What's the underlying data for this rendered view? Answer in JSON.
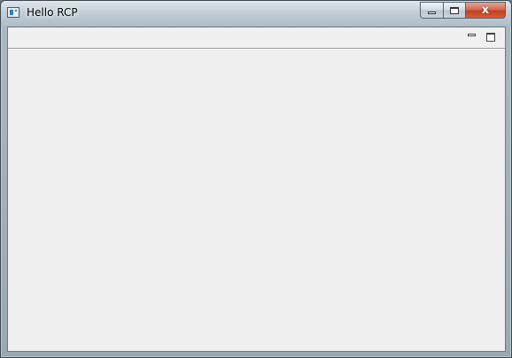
{
  "window": {
    "title": "Hello RCP",
    "icon": "app-window-icon",
    "caption_buttons": [
      {
        "name": "minimize",
        "icon": "minimize-icon"
      },
      {
        "name": "maximize",
        "icon": "maximize-icon"
      },
      {
        "name": "close",
        "icon": "close-icon",
        "glyph": "x"
      }
    ]
  },
  "view_toolbar": {
    "buttons": [
      {
        "name": "minimize-view",
        "icon": "minimize-icon"
      },
      {
        "name": "maximize-view",
        "icon": "maximize-icon"
      }
    ]
  },
  "colors": {
    "client_background": "#f0f0f0",
    "close_button": "#c1401f",
    "titlebar": "#c3ced6"
  }
}
